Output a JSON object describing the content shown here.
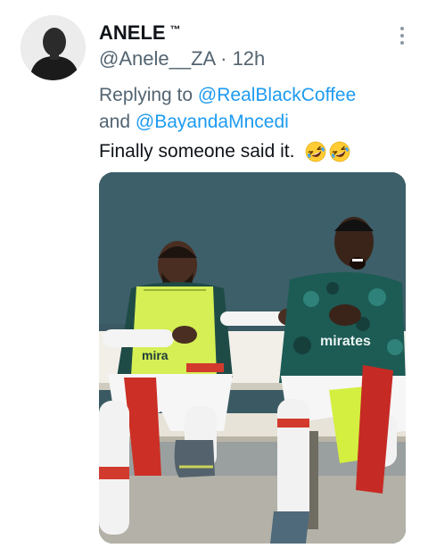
{
  "tweet": {
    "author_name": "ANELE",
    "author_badge": "™",
    "handle": "@Anele__ZA",
    "separator": "·",
    "time": "12h",
    "replying_prefix": "Replying to",
    "reply_mention_1": "@RealBlackCoffee",
    "reply_conjunction": "and",
    "reply_mention_2": "@BayandaMncedi",
    "text": "Finally someone said it.",
    "emojis": [
      "rolling-on-floor-laughing",
      "rolling-on-floor-laughing"
    ]
  },
  "media": {
    "description_icon": "photo",
    "jersey_text": "mirates"
  },
  "colors": {
    "link": "#1d9bf0",
    "muted": "#536471",
    "text": "#0f1419"
  }
}
